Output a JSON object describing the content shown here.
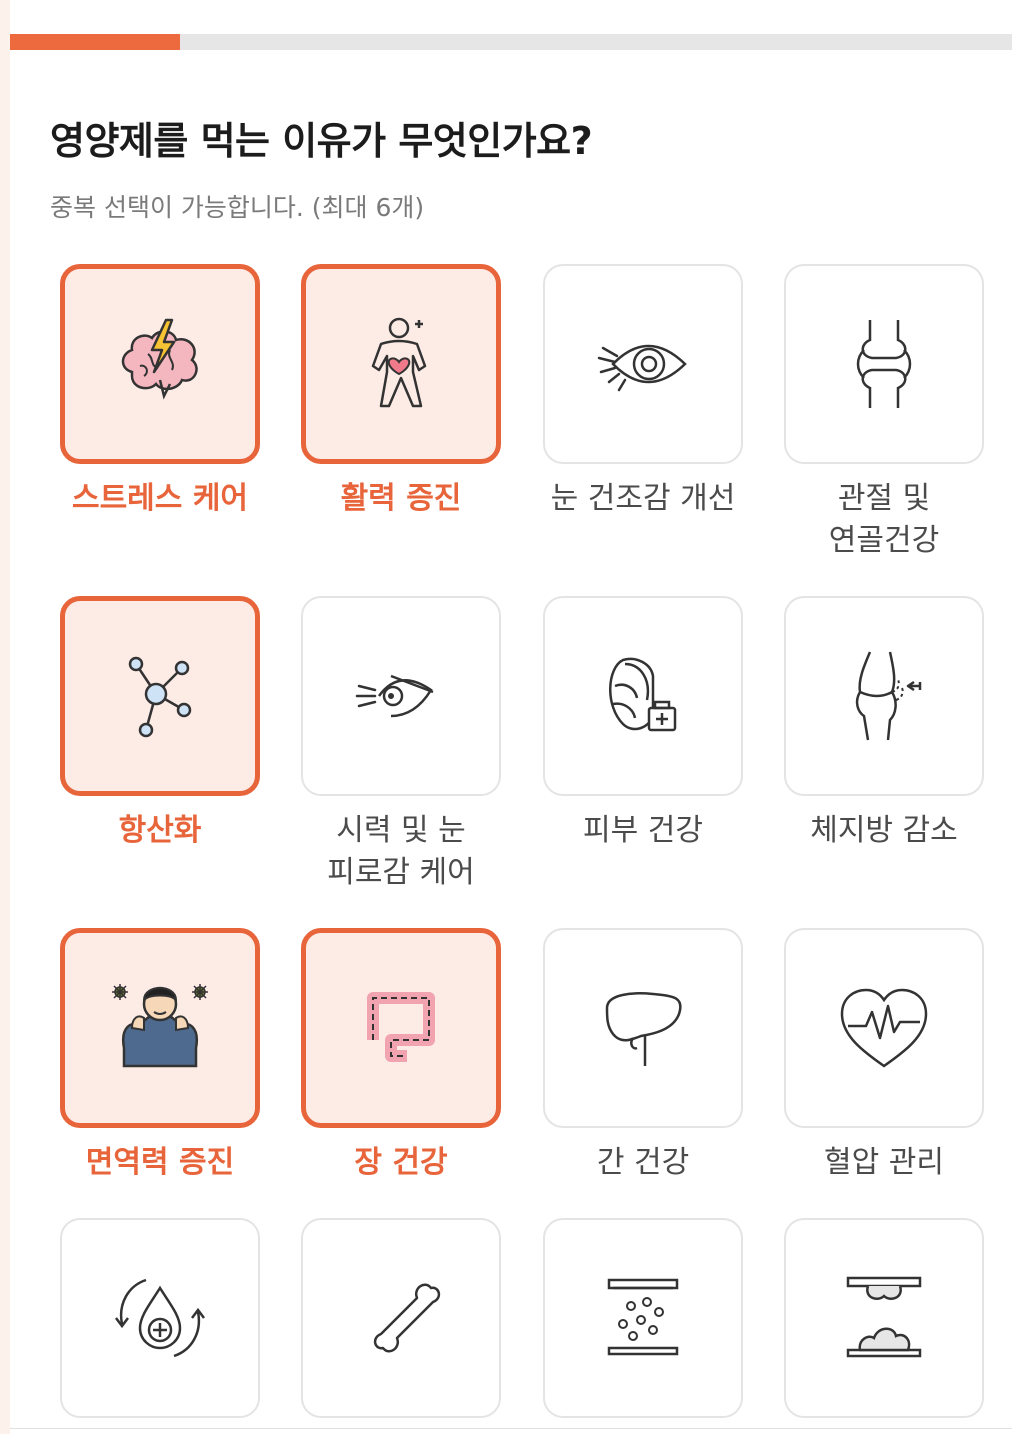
{
  "progress": {
    "fraction": 0.17
  },
  "colors": {
    "accent": "#e8643a",
    "selected_bg": "#fdece6",
    "card_border": "#e4e4e4"
  },
  "question": {
    "title": "영양제를 먹는 이유가 무엇인가요?",
    "subtitle": "중복 선택이 가능합니다. (최대 6개)"
  },
  "options": [
    {
      "label": "스트레스 케어",
      "icon": "stress-brain-icon",
      "selected": true
    },
    {
      "label": "활력 증진",
      "icon": "vitality-person-icon",
      "selected": true
    },
    {
      "label": "눈 건조감 개선",
      "icon": "dry-eye-icon",
      "selected": false
    },
    {
      "label": "관절 및\n연골건강",
      "icon": "joint-icon",
      "selected": false
    },
    {
      "label": "항산화",
      "icon": "molecule-icon",
      "selected": true
    },
    {
      "label": "시력 및 눈\n피로감 케어",
      "icon": "eye-strain-icon",
      "selected": false
    },
    {
      "label": "피부 건강",
      "icon": "skin-care-icon",
      "selected": false
    },
    {
      "label": "체지방 감소",
      "icon": "waist-icon",
      "selected": false
    },
    {
      "label": "면역력 증진",
      "icon": "immune-person-icon",
      "selected": true
    },
    {
      "label": "장 건강",
      "icon": "intestine-icon",
      "selected": true
    },
    {
      "label": "간 건강",
      "icon": "liver-icon",
      "selected": false
    },
    {
      "label": "혈압 관리",
      "icon": "heart-pulse-icon",
      "selected": false
    },
    {
      "label": "",
      "icon": "blood-drop-cycle-icon",
      "selected": false
    },
    {
      "label": "",
      "icon": "bone-icon",
      "selected": false
    },
    {
      "label": "",
      "icon": "particles-press-icon",
      "selected": false
    },
    {
      "label": "",
      "icon": "press-mound-icon",
      "selected": false
    }
  ]
}
